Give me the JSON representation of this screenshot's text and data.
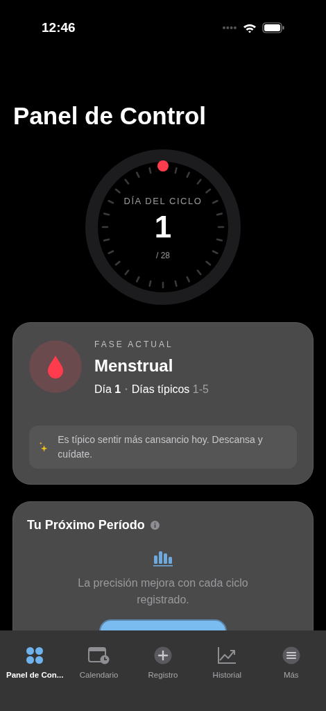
{
  "status_bar": {
    "time": "12:46"
  },
  "title": "Panel de Control",
  "dial": {
    "label": "DÍA DEL CICLO",
    "day": "1",
    "total": "/ 28"
  },
  "phase_card": {
    "eyebrow": "FASE ACTUAL",
    "phase": "Menstrual",
    "day_label": "Día",
    "day_value": "1",
    "separator": "•",
    "typical_label": "Días típicos",
    "typical_range": "1-5",
    "tip": "Es típico sentir más cansancio hoy. Descansa y cuídate."
  },
  "next_period_card": {
    "title": "Tu Próximo Período",
    "message": "La precisión mejora con cada ciclo registrado."
  },
  "tab_bar": [
    {
      "kind": "grid",
      "label": "Panel de Con...",
      "selected": true
    },
    {
      "kind": "calendar",
      "label": "Calendario",
      "selected": false
    },
    {
      "kind": "plus",
      "label": "Registro",
      "selected": false
    },
    {
      "kind": "chart",
      "label": "Historial",
      "selected": false
    },
    {
      "kind": "menu",
      "label": "Más",
      "selected": false
    }
  ]
}
